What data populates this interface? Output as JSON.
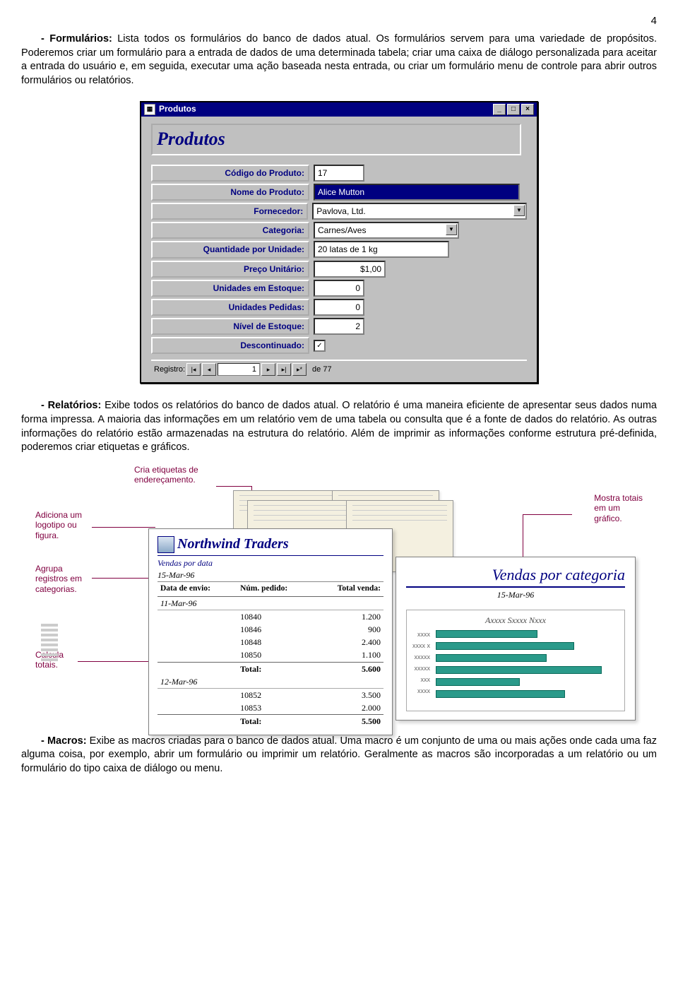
{
  "page_number": "4",
  "para1_lead": "- Formulários:",
  "para1_body": " Lista todos os formulários do banco de dados atual. Os formulários servem para uma variedade de propósitos. Poderemos criar um formulário para a entrada de dados de uma determinada tabela; criar uma caixa de diálogo personalizada para aceitar a entrada do usuário e, em seguida, executar uma ação baseada nesta entrada, ou criar um formulário menu de controle para abrir outros formulários ou relatórios.",
  "form": {
    "window_title": "Produtos",
    "title": "Produtos",
    "labels": {
      "codigo": "Código do Produto:",
      "nome": "Nome do Produto:",
      "fornecedor": "Fornecedor:",
      "categoria": "Categoria:",
      "qtd": "Quantidade por Unidade:",
      "preco": "Preço Unitário:",
      "estoque": "Unidades em Estoque:",
      "pedidas": "Unidades Pedidas:",
      "nivel": "Nível de Estoque:",
      "desc": "Descontinuado:"
    },
    "values": {
      "codigo": "17",
      "nome": "Alice Mutton",
      "fornecedor": "Pavlova, Ltd.",
      "categoria": "Carnes/Aves",
      "qtd": "20 latas de 1 kg",
      "preco": "$1,00",
      "estoque": "0",
      "pedidas": "0",
      "nivel": "2",
      "desc_checked": "✓"
    },
    "record": {
      "label": "Registro:",
      "num": "1",
      "of": "de  77"
    }
  },
  "para2_lead": "- Relatórios:",
  "para2_body": " Exibe todos os relatórios do banco de dados atual. O relatório é uma maneira eficiente de apresentar seus dados numa forma impressa. A maioria das informações em um relatório vem de uma tabela ou consulta que é a fonte de dados do relatório. As outras informações do relatório estão armazenadas na estrutura do relatório. Além de imprimir as informações conforme estrutura pré-definida, poderemos criar etiquetas e gráficos.",
  "reports": {
    "callouts": {
      "logo": "Adiciona um\nlogotipo ou\nfigura.",
      "agrupa": "Agrupa\nregistros em\ncategorias.",
      "calcula": "Calcula\ntotais.",
      "etiquetas": "Cria etiquetas de\nendereçamento.",
      "totais": "Mostra totais\nem um\ngráfico."
    },
    "rpt1": {
      "company": "Northwind Traders",
      "subtitle": "Vendas por data",
      "topdate": "15-Mar-96",
      "headers": [
        "Data de envio:",
        "Núm. pedido:",
        "Total venda:"
      ],
      "group1": "11-Mar-96",
      "rows1": [
        [
          "",
          "10840",
          "1.200"
        ],
        [
          "",
          "10846",
          "900"
        ],
        [
          "",
          "10848",
          "2.400"
        ],
        [
          "",
          "10850",
          "1.100"
        ]
      ],
      "total1_label": "Total:",
      "total1": "5.600",
      "group2": "12-Mar-96",
      "rows2": [
        [
          "",
          "10852",
          "3.500"
        ],
        [
          "",
          "10853",
          "2.000"
        ]
      ],
      "total2_label": "Total:",
      "total2": "5.500"
    },
    "rpt2": {
      "title": "Vendas por categoria",
      "date": "15-Mar-96",
      "chart_title": "Axxxx Sxxxx Nxxx",
      "labels": [
        "xxxx",
        "xxxx x",
        "xxxxx",
        "xxxxx",
        "xxx",
        "xxxx"
      ]
    }
  },
  "chart_data": {
    "type": "bar",
    "title": "Axxxx Sxxxx Nxxx",
    "categories": [
      "xxxx",
      "xxxx x",
      "xxxxx",
      "xxxxx",
      "xxx",
      "xxxx"
    ],
    "values": [
      55,
      75,
      60,
      90,
      45,
      70
    ],
    "orientation": "horizontal",
    "xlim": [
      0,
      100
    ],
    "xlabel": "",
    "ylabel": ""
  },
  "para3_lead": "- Macros:",
  "para3_body": " Exibe as macros criadas para o banco de dados atual. Uma macro é um conjunto de uma ou mais ações onde cada uma faz alguma coisa, por exemplo, abrir um formulário ou imprimir um relatório. Geralmente as macros são incorporadas a um relatório ou um formulário do tipo caixa de diálogo ou menu."
}
